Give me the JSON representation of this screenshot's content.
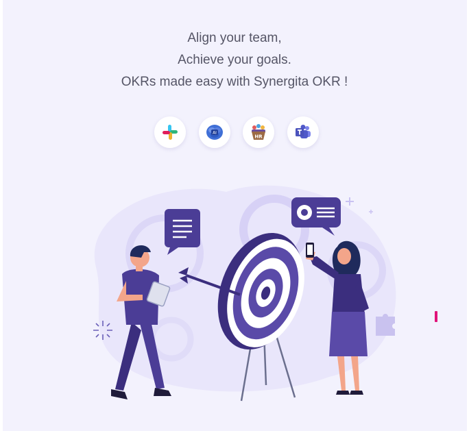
{
  "hero": {
    "line1": "Align your team,",
    "line2": "Achieve your goals.",
    "line3": "OKRs made easy with Synergita OKR !"
  },
  "integrations": [
    {
      "icon": "slack-icon",
      "label": "Slack"
    },
    {
      "icon": "brain-ai-icon",
      "label": "AI"
    },
    {
      "icon": "hr-icon",
      "label": "HR"
    },
    {
      "icon": "microsoft-teams-icon",
      "label": "Teams"
    }
  ],
  "hr_badge_text": "HR",
  "ai_badge_text": "AI",
  "colors": {
    "background": "#f3f2fd",
    "heading_text": "#555566",
    "primary_purple": "#5a4aa8",
    "dark_purple": "#3b2e7e",
    "light_purple": "#e2defa",
    "accent_pink": "#e0147a"
  }
}
